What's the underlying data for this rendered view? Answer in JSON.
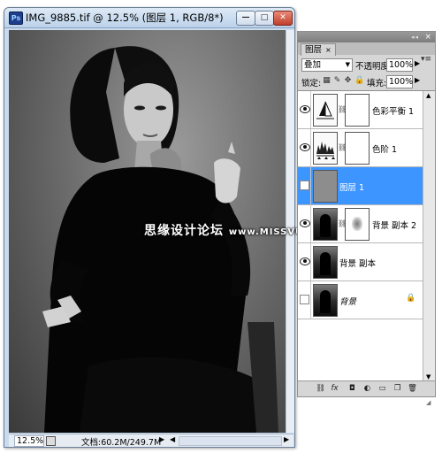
{
  "document": {
    "title": "IMG_9885.tif @ 12.5% (图层 1, RGB/8*)",
    "app_icon_text": "Ps",
    "buttons": {
      "minimize": "—",
      "maximize": "□",
      "close": "✕"
    },
    "status": {
      "zoom": "12.5%",
      "size": "文档:60.2M/249.7M",
      "arrow": "▶"
    }
  },
  "watermark": {
    "text": "思缘设计论坛",
    "url": "www.MISSVUAN.com"
  },
  "layers_panel": {
    "tab": "图层",
    "tab_close": "×",
    "menu_icon": "▾≡",
    "blend_mode": "叠加",
    "opacity_label": "不透明度:",
    "opacity": "100%",
    "lock_label": "锁定:",
    "lock_icons": [
      "lock-transparent-icon",
      "lock-image-icon",
      "lock-position-icon",
      "lock-all-icon"
    ],
    "fill_label": "填充:",
    "fill": "100%",
    "layers": [
      {
        "name": "色彩平衡 1",
        "visible": true,
        "selected": false,
        "type": "adjustment"
      },
      {
        "name": "色阶 1",
        "visible": true,
        "selected": false,
        "type": "adjustment"
      },
      {
        "name": "图层 1",
        "visible": false,
        "selected": true,
        "type": "pixel"
      },
      {
        "name": "背景 副本 2",
        "visible": true,
        "selected": false,
        "type": "masked"
      },
      {
        "name": "背景 副本",
        "visible": true,
        "selected": false,
        "type": "pixel"
      },
      {
        "name": "背景",
        "visible": false,
        "selected": false,
        "type": "background",
        "locked": true
      }
    ],
    "footer_icons": [
      "link-layers-icon",
      "layer-style-icon",
      "add-mask-icon",
      "adjustment-layer-icon",
      "group-folder-icon",
      "new-layer-icon",
      "delete-trash-icon"
    ]
  }
}
